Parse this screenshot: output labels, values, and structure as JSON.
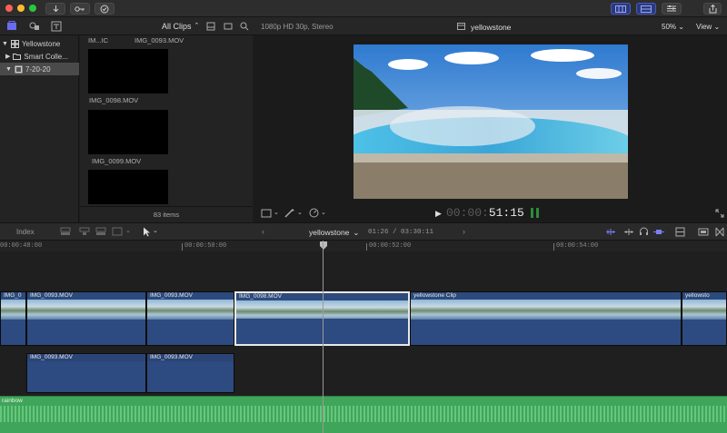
{
  "window": {
    "traffic_lights": [
      "#fe5f57",
      "#febc2e",
      "#28c840"
    ]
  },
  "titlebar": {
    "icons": [
      "import-icon",
      "key-icon",
      "checkmark-icon"
    ],
    "right_icons": [
      "layout-browser-icon",
      "layout-timeline-icon",
      "inspector-icon",
      "share-icon"
    ]
  },
  "browser_toolbar": {
    "filter_label": "All Clips",
    "item_count": "83 items"
  },
  "library": {
    "items": [
      {
        "label": "Yellowstone",
        "icon": "library-icon"
      },
      {
        "label": "Smart Colle...",
        "icon": "folder-icon"
      },
      {
        "label": "7-20-20",
        "icon": "event-icon"
      }
    ]
  },
  "clips": [
    {
      "title_left": "IM...IC",
      "title_right": "IMG_0093.MOV"
    },
    {
      "title_left": "IMG_0098.MOV"
    },
    {
      "title_left": "IMG_0099.MOV"
    }
  ],
  "viewer": {
    "format": "1080p HD 30p, Stereo",
    "project": "yellowstone",
    "zoom": "50%",
    "view_label": "View",
    "timecode_dim": "00:00:",
    "timecode": "51:15"
  },
  "timeline_toolbar": {
    "index_label": "Index",
    "project_name": "yellowstone",
    "duration": "01:26 / 03:30:11"
  },
  "ruler": {
    "marks": [
      "00:00:48:00",
      "00:00:50:00",
      "00:00:52:00",
      "00:00:54:00"
    ]
  },
  "timeline": {
    "primary": [
      {
        "name": "IMG_0"
      },
      {
        "name": "IMG_0093.MOV"
      },
      {
        "name": "IMG_0093.MOV"
      },
      {
        "name": "IMG_0098.MOV"
      },
      {
        "name": "yellowstone Clip"
      },
      {
        "name": "yellowsto"
      }
    ],
    "connected": [
      {
        "name": "IMG_0093.MOV"
      },
      {
        "name": "IMG_0093.MOV"
      }
    ],
    "audio": {
      "name": "rainbow"
    }
  },
  "colors": {
    "accent": "#ff3f7f",
    "audio_green": "#3fa55a",
    "clip_blue": "#2c4a7c"
  }
}
